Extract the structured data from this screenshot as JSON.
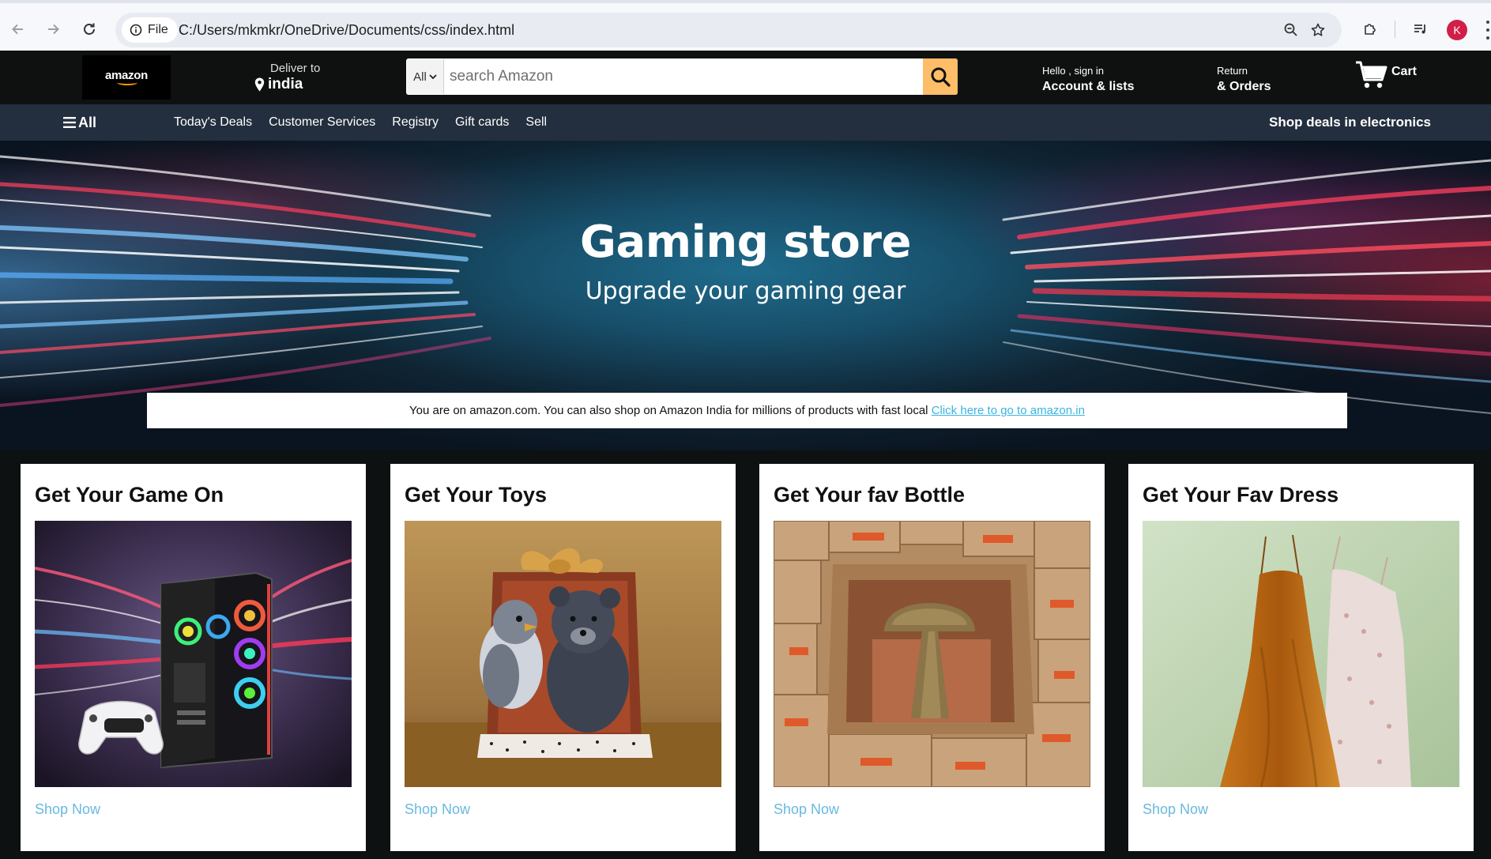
{
  "browser": {
    "site_chip_label": "File",
    "url": "C:/Users/mkmkr/OneDrive/Documents/css/index.html",
    "profile_initial": "K"
  },
  "header": {
    "logo_text": "amazon",
    "deliver_label": "Deliver to",
    "deliver_location": "india",
    "search_category": "All",
    "search_placeholder": "search Amazon",
    "account_line1": "Hello , sign in",
    "account_line2": "Account & lists",
    "returns_line1": "Return",
    "returns_line2": "& Orders",
    "cart_label": "Cart"
  },
  "subnav": {
    "all_label": "All",
    "links": [
      "Today's Deals",
      "Customer Services",
      "Registry",
      "Gift cards",
      "Sell"
    ],
    "right_label": "Shop deals in electronics"
  },
  "hero": {
    "title": "Gaming store",
    "subtitle": "Upgrade your gaming gear"
  },
  "notice": {
    "text": "You are on amazon.com. You can also shop on Amazon India for millions of products with fast local ",
    "link_text": "Click here to go to amazon.in"
  },
  "cards": [
    {
      "title": "Get Your Game On",
      "link": "Shop Now",
      "image": "gaming-pc-with-controller"
    },
    {
      "title": "Get Your Toys",
      "link": "Shop Now",
      "image": "plush-toys-in-gift-box"
    },
    {
      "title": "Get Your fav Bottle",
      "link": "Shop Now",
      "image": "lamp-in-amazon-boxes"
    },
    {
      "title": "Get Your Fav Dress",
      "link": "Shop Now",
      "image": "hanging-dresses"
    }
  ],
  "colors": {
    "nav_bg": "#0f1111",
    "subnav_bg": "#232f3e",
    "search_button": "#febd69",
    "link": "#69b9de",
    "logo_accent": "#ff9900"
  }
}
